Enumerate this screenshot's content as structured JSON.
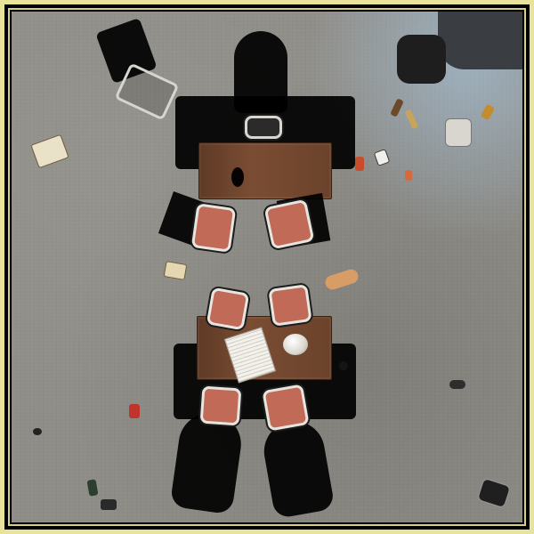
{
  "scene": {
    "view": "top-down",
    "palette": {
      "frame": "#e8e29a",
      "floor": "#8f8d87",
      "table": "#7a4d33",
      "chair_seat": "#c26a58",
      "chair_frame": "#e7e5e0",
      "shadow": "#000000"
    },
    "objects": [
      "table-top",
      "table-bottom",
      "folding-chair",
      "newspaper",
      "bowl",
      "cup",
      "bottle",
      "can",
      "cigarette-pack",
      "paper-bag",
      "trash"
    ]
  }
}
